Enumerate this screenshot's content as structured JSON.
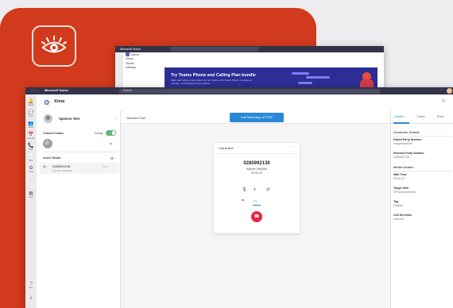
{
  "colors": {
    "brand_red": "#d13a1c",
    "teams_purple": "#5b5fc7",
    "recording_blue": "#2b88d8",
    "hangup_red": "#e02a4a",
    "toggle_green": "#5fb879"
  },
  "logo": {
    "icon": "eye-icon"
  },
  "back_window": {
    "title": "Microsoft Teams",
    "search_placeholder": "Search",
    "nav": [
      "Admin",
      "Home",
      "Teams",
      "Settings"
    ],
    "banner_title": "Try Teams Phone and Calling Plan bundle",
    "banner_sub": "Make and receive voice calls from any device with Teams Phone, an easy-to-manage, cloud-based phone solution."
  },
  "window": {
    "title": "Microsoft Teams",
    "search_placeholder": "Search",
    "more": "···"
  },
  "rail": [
    {
      "icon": "bell-icon",
      "glyph": "🔔",
      "label": "Activity"
    },
    {
      "icon": "chat-icon",
      "glyph": "💬",
      "label": "Chat"
    },
    {
      "icon": "teams-icon",
      "glyph": "👥",
      "label": "Teams"
    },
    {
      "icon": "calendar-icon",
      "glyph": "📅",
      "label": "Calendar"
    },
    {
      "icon": "calls-icon",
      "glyph": "📞",
      "label": "Calls"
    },
    {
      "icon": "files-icon",
      "glyph": "📄",
      "label": "Files"
    },
    {
      "icon": "xima-icon",
      "glyph": "✿",
      "label": "Xima"
    },
    {
      "icon": "more-icon",
      "glyph": "···",
      "label": ""
    },
    {
      "icon": "apps-icon",
      "glyph": "▦",
      "label": "Apps"
    },
    {
      "icon": "help-icon",
      "glyph": "?",
      "label": "Help"
    },
    {
      "icon": "download-icon",
      "glyph": "⤓",
      "label": ""
    }
  ],
  "app": {
    "name": "Xima"
  },
  "agent": {
    "name": "Spencer Test"
  },
  "channel_status": {
    "label": "Channel Status",
    "value": "Ready"
  },
  "dialer": {
    "avatar_glyph": "✆",
    "icon_glyph": "⌗"
  },
  "active_media": {
    "label": "Active Media",
    "item": {
      "number": "0285992136",
      "sub": "Spencer TestXIMA",
      "time": "1 min"
    }
  },
  "inbound_label": "Inbound Call",
  "recording_button": "Call Recording: ACTIVE",
  "call_card": {
    "title": "Call Active",
    "more": "···",
    "number": "0285992136",
    "name": "Spencer TestXIMA",
    "timer": "00:00:25"
  },
  "controls": [
    {
      "icon": "mute-icon",
      "glyph": "🎙"
    },
    {
      "icon": "hold-icon",
      "glyph": "⏸"
    },
    {
      "icon": "transfer-icon",
      "glyph": "⇄"
    },
    {
      "icon": "dialpad-icon",
      "glyph": "⌗"
    },
    {
      "icon": "record-icon",
      "glyph": "•••"
    }
  ],
  "hangup_glyph": "☎",
  "tabs": [
    "Details",
    "Notes",
    "Enter"
  ],
  "details": {
    "customer_header": "Customer Details",
    "dialed_label": "Dialed Party Number",
    "dialed_value": "mappedparties",
    "external_label": "External Party Number",
    "external_value": "0285992136",
    "media_header": "Media Details",
    "wait_label": "Wait Time",
    "wait_value": "00:00:12",
    "skill_label": "Target Skill",
    "skill_value": "GP Appointments",
    "tag_label": "Tag",
    "tag_value": "Default",
    "direction_label": "Call Direction",
    "direction_value": "Inbound"
  }
}
